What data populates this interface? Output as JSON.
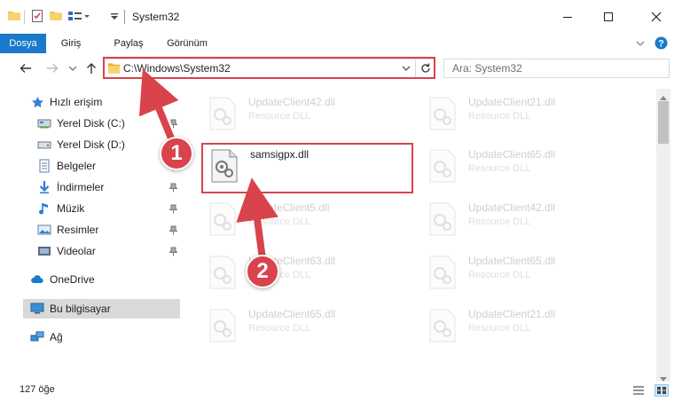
{
  "window": {
    "title": "System32"
  },
  "ribbon": {
    "tabs": [
      "Dosya",
      "Giriş",
      "Paylaş",
      "Görünüm"
    ]
  },
  "address": {
    "path": "C:\\Windows\\System32"
  },
  "search": {
    "placeholder": "Ara: System32"
  },
  "sidebar": {
    "quick_access": "Hızlı erişim",
    "items": [
      "Yerel Disk (C:)",
      "Yerel Disk (D:)",
      "Belgeler",
      "İndirmeler",
      "Müzik",
      "Resimler",
      "Videolar"
    ],
    "onedrive": "OneDrive",
    "this_pc": "Bu bilgisayar",
    "network": "Ağ"
  },
  "files": {
    "type_label": "Resource DLL",
    "left_column": [
      "UpdateClient42.dll",
      "samsigpx.dll",
      "UpdateClient5.dll",
      "UpdateClient63.dll",
      "UpdateClient65.dll"
    ],
    "right_column": [
      "UpdateClient21.dll",
      "UpdateClient65.dll",
      "UpdateClient42.dll",
      "UpdateClient65.dll",
      "UpdateClient21.dll"
    ]
  },
  "status": {
    "count": "127 öğe"
  },
  "annotations": {
    "step1": "1",
    "step2": "2"
  },
  "colors": {
    "accent": "#1979ca",
    "highlight": "#d9434b",
    "folder": "#f3c34a"
  },
  "icons": [
    "folder-icon",
    "properties-icon",
    "new-folder-icon",
    "customize-icon",
    "minimize-icon",
    "maximize-icon",
    "close-icon",
    "help-icon",
    "back-icon",
    "forward-icon",
    "recent-icon",
    "up-icon",
    "refresh-icon",
    "pin-icon",
    "star-icon",
    "drive-icon",
    "documents-icon",
    "download-icon",
    "music-icon",
    "pictures-icon",
    "videos-icon",
    "onedrive-icon",
    "computer-icon",
    "network-icon",
    "dll-file-icon",
    "details-view-icon",
    "large-icons-view-icon"
  ]
}
